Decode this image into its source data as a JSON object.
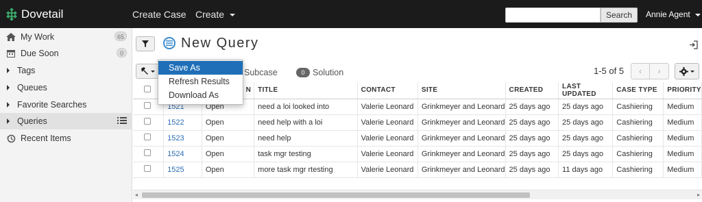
{
  "app": {
    "brand": "Dovetail"
  },
  "nav": {
    "create_case": "Create Case",
    "create": "Create",
    "search_button": "Search",
    "search_value": "",
    "user": "Annie Agent"
  },
  "sidebar": {
    "items": [
      {
        "label": "My Work",
        "badge": "65",
        "icon": "home-icon"
      },
      {
        "label": "Due Soon",
        "badge": "0",
        "icon": "calendar-icon"
      },
      {
        "label": "Tags"
      },
      {
        "label": "Queues"
      },
      {
        "label": "Favorite Searches"
      },
      {
        "label": "Queries",
        "active": true
      },
      {
        "label": "Recent Items",
        "icon": "history-icon"
      }
    ]
  },
  "main": {
    "title": "New Query",
    "tabs": {
      "subcase": "Subcase",
      "solution_count": "0",
      "solution": "Solution"
    },
    "pager": {
      "range": "1-5",
      "of": "of",
      "total": "5"
    }
  },
  "dropdown": {
    "items": [
      "Save As",
      "Refresh Results",
      "Download As"
    ],
    "active_index": 0
  },
  "table": {
    "headers": [
      "",
      "",
      "N",
      "TITLE",
      "CONTACT",
      "SITE",
      "CREATED",
      "LAST UPDATED",
      "CASE TYPE",
      "PRIORITY"
    ],
    "rows": [
      {
        "id": "1521",
        "status": "Open",
        "title": "need a loi looked into",
        "contact": "Valerie Leonard",
        "site": "Grinkmeyer and Leonard",
        "created": "25 days ago",
        "updated": "25 days ago",
        "type": "Cashiering",
        "priority": "Medium"
      },
      {
        "id": "1522",
        "status": "Open",
        "title": "need help with a loi",
        "contact": "Valerie Leonard",
        "site": "Grinkmeyer and Leonard",
        "created": "25 days ago",
        "updated": "25 days ago",
        "type": "Cashiering",
        "priority": "Medium"
      },
      {
        "id": "1523",
        "status": "Open",
        "title": "need help",
        "contact": "Valerie Leonard",
        "site": "Grinkmeyer and Leonard",
        "created": "25 days ago",
        "updated": "25 days ago",
        "type": "Cashiering",
        "priority": "Medium"
      },
      {
        "id": "1524",
        "status": "Open",
        "title": "task mgr testing",
        "contact": "Valerie Leonard",
        "site": "Grinkmeyer and Leonard",
        "created": "25 days ago",
        "updated": "25 days ago",
        "type": "Cashiering",
        "priority": "Medium"
      },
      {
        "id": "1525",
        "status": "Open",
        "title": "more task mgr rtesting",
        "contact": "Valerie Leonard",
        "site": "Grinkmeyer and Leonard",
        "created": "25 days ago",
        "updated": "11 days ago",
        "type": "Cashiering",
        "priority": "Medium"
      }
    ]
  },
  "colors": {
    "navbar": "#1b1b1b",
    "accent": "#1f6fb8",
    "link": "#2a6db5",
    "brand_green": "#3aa86b"
  }
}
